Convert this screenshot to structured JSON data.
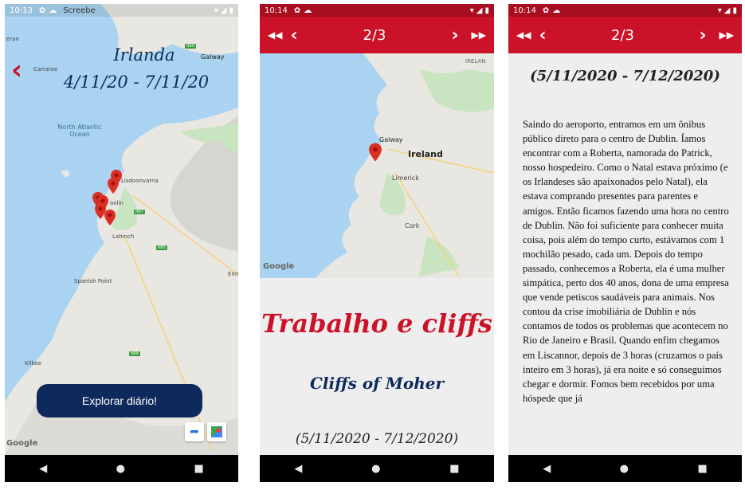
{
  "phone1": {
    "status": {
      "time": "10:13",
      "carrier": "Screebe"
    },
    "title": "Irlanda",
    "dates": "4/11/20 - 7/11/20",
    "map_labels": {
      "ocean": "North Atlantic Ocean",
      "galway": "Galway",
      "carraroe": "Carraroe",
      "lisdoonvarna": "Lisdoonvarna",
      "doolin": "oolin",
      "lahinch": "Lahinch",
      "spanish_point": "Spanish Point",
      "kilkee": "Kilkee",
      "erin": "Enn",
      "road_n59": "N59",
      "road_n67": "N67",
      "road_n85": "N85",
      "road_n68": "N68",
      "google": "Google"
    },
    "explore_button": "Explorar diário!"
  },
  "phone2": {
    "status": {
      "time": "10:14"
    },
    "counter": "2/3",
    "map_labels": {
      "galway": "Galway",
      "ireland": "Ireland",
      "limerick": "Limerick",
      "cork": "Cork",
      "irelan": "IRELAN",
      "google": "Google"
    },
    "title": "Trabalho e cliffs",
    "subtitle": "Cliffs of Moher",
    "dates": "(5/11/2020 - 7/12/2020)"
  },
  "phone3": {
    "status": {
      "time": "10:14"
    },
    "counter": "2/3",
    "dates": "(5/11/2020 - 7/12/2020)",
    "body": "Saindo do aeroporto, entramos em um ônibus público direto para o centro de Dublin. Íamos encontrar com a Roberta, namorada do Patrick, nosso hospedeiro. Como o Natal estava próximo (e os Irlandeses são apaixonados pelo Natal), ela estava comprando presentes para parentes e amigos. Então ficamos fazendo uma hora no centro de Dublin. Não foi suficiente para conhecer muita coisa, pois além do tempo curto, estávamos com 1 mochilão pesado, cada um. Depois do tempo passado, conhecemos a Roberta, ela é uma mulher simpática, perto dos 40 anos, dona de uma empresa que vende petiscos saudáveis para animais. Nos contou da crise imobiliária de Dublin e nós contamos de todos os problemas que acontecem no Rio de Janeiro e Brasil. Quando enfim chegamos em Liscannor, depois de 3 horas (cruzamos o país inteiro em 3 horas), já era noite e só conseguimos chegar e dormir. Fomos bem recebidos por uma hóspede que já"
  },
  "colors": {
    "accent_red": "#cc1228",
    "navy": "#0e2a5c",
    "ocean": "#a9d3f0",
    "land": "#e8e7e2",
    "green": "#c8e4c0"
  },
  "icons": [
    "settings-icon",
    "cloud-icon",
    "wifi-icon",
    "signal-icon",
    "battery-icon",
    "back-chevron-icon",
    "rewind-icon",
    "prev-icon",
    "next-icon",
    "fast-forward-icon",
    "location-pin-icon",
    "directions-icon",
    "maps-icon",
    "nav-back-icon",
    "nav-home-icon",
    "nav-recents-icon"
  ]
}
